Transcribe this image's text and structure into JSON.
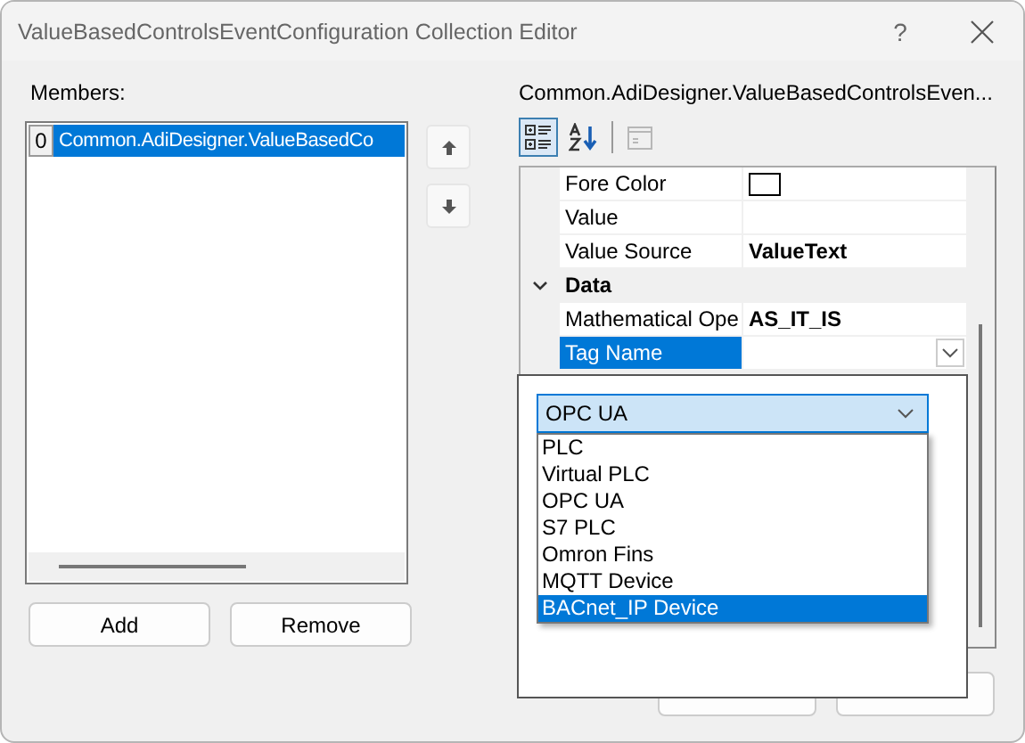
{
  "window": {
    "title": "ValueBasedControlsEventConfiguration Collection Editor",
    "help_button": "?"
  },
  "members": {
    "label": "Members:",
    "items": [
      {
        "index": "0",
        "text": "Common.AdiDesigner.ValueBasedCo",
        "selected": true
      }
    ]
  },
  "member_buttons": [
    "Add",
    "Remove"
  ],
  "properties": {
    "title": "Common.AdiDesigner.ValueBasedControlsEven...",
    "toolbar": [
      {
        "kind": "categorized",
        "selected": true,
        "disabled": false
      },
      {
        "kind": "alphabetical",
        "selected": false,
        "disabled": false
      },
      {
        "kind": "pages",
        "selected": false,
        "disabled": true
      }
    ],
    "rows": [
      {
        "kind": "color",
        "name": "Fore Color",
        "color": "#ffffff",
        "selected": false
      },
      {
        "kind": "text",
        "name": "Value",
        "selected": false
      },
      {
        "kind": "text",
        "name": "Value Source",
        "value": "ValueText",
        "selected": false
      },
      {
        "kind": "category",
        "name": "Data",
        "expanded": true,
        "selected": false
      },
      {
        "kind": "text",
        "name": "Mathematical Ope",
        "value": "AS_IT_IS",
        "selected": false
      },
      {
        "kind": "dropdown",
        "name": "Tag Name",
        "selected": true
      }
    ]
  },
  "dropdown_editor": {
    "combo": {
      "value": "OPC UA"
    },
    "options": [
      {
        "text": "PLC",
        "selected": false
      },
      {
        "text": "Virtual PLC",
        "selected": false
      },
      {
        "text": "OPC UA",
        "selected": false
      },
      {
        "text": "S7 PLC",
        "selected": false
      },
      {
        "text": "Omron Fins",
        "selected": false
      },
      {
        "text": "MQTT Device",
        "selected": false
      },
      {
        "text": "BACnet_IP Device",
        "selected": true
      }
    ]
  }
}
